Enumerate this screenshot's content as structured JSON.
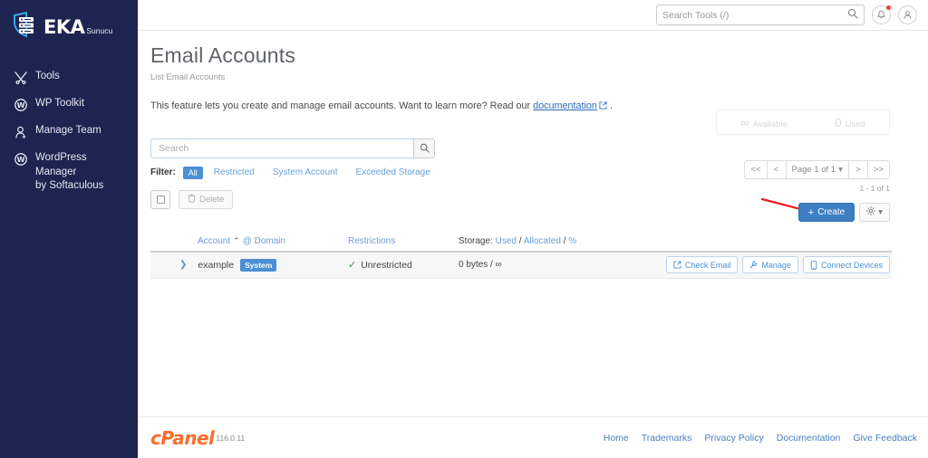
{
  "sidebar": {
    "logo": {
      "brand": "EKA",
      "suffix": "Sunucu",
      "icon": "shield-server-icon"
    },
    "items": [
      {
        "label": "Tools",
        "icon": "tools-icon"
      },
      {
        "label": "WP Toolkit",
        "icon": "wordpress-icon"
      },
      {
        "label": "Manage Team",
        "icon": "manage-team-icon"
      },
      {
        "label": "WordPress Manager\nby Softaculous",
        "icon": "wordpress-icon"
      }
    ]
  },
  "topbar": {
    "search": {
      "placeholder": "Search Tools (/)",
      "value": "",
      "icon": "search-icon"
    },
    "notifications_icon": "bell-icon",
    "account_icon": "user-icon"
  },
  "page": {
    "title": "Email Accounts",
    "subtitle": "List Email Accounts",
    "description_prefix": "This feature lets you create and manage email accounts. Want to learn more? Read our ",
    "description_link": "documentation",
    "description_suffix": " ."
  },
  "stats": {
    "available_value": "∞",
    "available_label": "Available",
    "used_value": "0",
    "used_label": "Used"
  },
  "toolbar": {
    "search_placeholder": "Search",
    "search_value": "",
    "search_button_icon": "search-icon",
    "filter_label": "Filter:",
    "filters": [
      {
        "label": "All",
        "active": true
      },
      {
        "label": "Restricted",
        "active": false
      },
      {
        "label": "System Account",
        "active": false
      },
      {
        "label": "Exceeded Storage",
        "active": false
      }
    ],
    "select_all_checkbox": "",
    "delete_label": "Delete",
    "delete_icon": "trash-icon",
    "create_label": "Create",
    "create_icon": "plus-icon",
    "gear_icon": "gear-icon",
    "gear_caret": "▾"
  },
  "pagination": {
    "first": "<<",
    "prev": "<",
    "page_label": "Page 1 of 1",
    "page_caret": "▾",
    "next": ">",
    "last": ">>",
    "range": "1 - 1 of 1"
  },
  "table": {
    "headers": {
      "account": "Account",
      "sort_caret": "⌃",
      "at": "@",
      "domain": "Domain",
      "restrictions": "Restrictions",
      "storage_prefix": "Storage:",
      "storage_used": "Used",
      "storage_sep1": "/",
      "storage_allocated": "Allocated",
      "storage_sep2": "/",
      "storage_pct": "%"
    },
    "rows": [
      {
        "expand_icon": "chevron-right-icon",
        "account": "example",
        "badge": "System",
        "restriction_icon": "check-icon",
        "restrictions": "Unrestricted",
        "storage": "0 bytes / ∞",
        "actions": [
          {
            "label": "Check Email",
            "icon": "external-link-icon"
          },
          {
            "label": "Manage",
            "icon": "wrench-icon"
          },
          {
            "label": "Connect Devices",
            "icon": "mobile-icon"
          }
        ]
      }
    ]
  },
  "footer": {
    "logo_text": "cPanel",
    "version": "116.0.11",
    "links": [
      "Home",
      "Trademarks",
      "Privacy Policy",
      "Documentation",
      "Give Feedback"
    ]
  },
  "annotation": {
    "type": "red-arrow",
    "color": "#ee1c24",
    "points_to": "create-button"
  }
}
